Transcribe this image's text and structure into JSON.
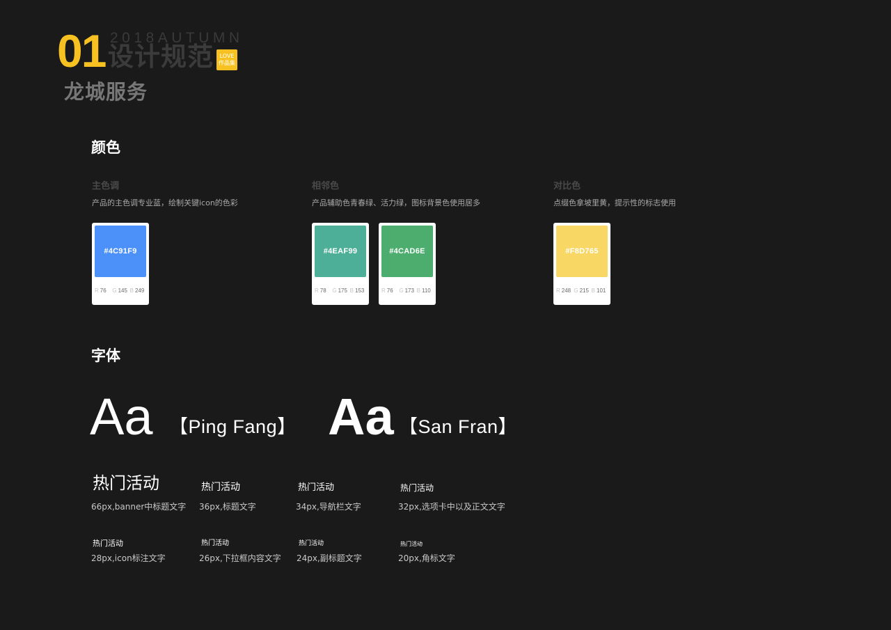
{
  "header": {
    "number": "01",
    "subtitle_en": "2018AUTUMN",
    "title": "设计规范",
    "badge": [
      "LOVE",
      "作品集"
    ],
    "brand": "龙城服务"
  },
  "colors_section": {
    "heading": "颜色",
    "groups": [
      {
        "title": "主色调",
        "desc": "产品的主色调专业蓝，绘制关键icon的色彩",
        "swatches": [
          {
            "hex": "#4C91F9",
            "color": "#4C91F9",
            "r": "76",
            "g": "145",
            "b": "249"
          }
        ]
      },
      {
        "title": "相邻色",
        "desc": "产品辅助色青春绿、活力绿，图标背景色使用居多",
        "swatches": [
          {
            "hex": "#4EAF99",
            "color": "#4EAF99",
            "r": "78",
            "g": "175",
            "b": "153"
          },
          {
            "hex": "#4CAD6E",
            "color": "#4CAD6E",
            "r": "76",
            "g": "173",
            "b": "110"
          }
        ]
      },
      {
        "title": "对比色",
        "desc": "点缀色拿坡里黄，提示性的标志使用",
        "swatches": [
          {
            "hex": "#F8D765",
            "color": "#F8D765",
            "r": "248",
            "g": "215",
            "b": "101"
          }
        ]
      }
    ],
    "rgb_labels": {
      "r": "R",
      "g": "G",
      "b": "B"
    }
  },
  "fonts_section": {
    "heading": "字体",
    "specimens": [
      {
        "glyph": "Aa",
        "name": "【Ping Fang】"
      },
      {
        "glyph": "Aa",
        "name": "【San Fran】"
      }
    ],
    "sizes": [
      {
        "sample": "热门活动",
        "caption": "66px,banner中标题文字"
      },
      {
        "sample": "热门活动",
        "caption": "36px,标题文字"
      },
      {
        "sample": "热门活动",
        "caption": "34px,导航栏文字"
      },
      {
        "sample": "热门活动",
        "caption": "32px,选项卡中以及正文文字"
      },
      {
        "sample": "热门活动",
        "caption": "28px,icon标注文字"
      },
      {
        "sample": "热门活动",
        "caption": "26px,下拉框内容文字"
      },
      {
        "sample": "热门活动",
        "caption": "24px,副标题文字"
      },
      {
        "sample": "热门活动",
        "caption": "20px,角标文字"
      }
    ]
  }
}
